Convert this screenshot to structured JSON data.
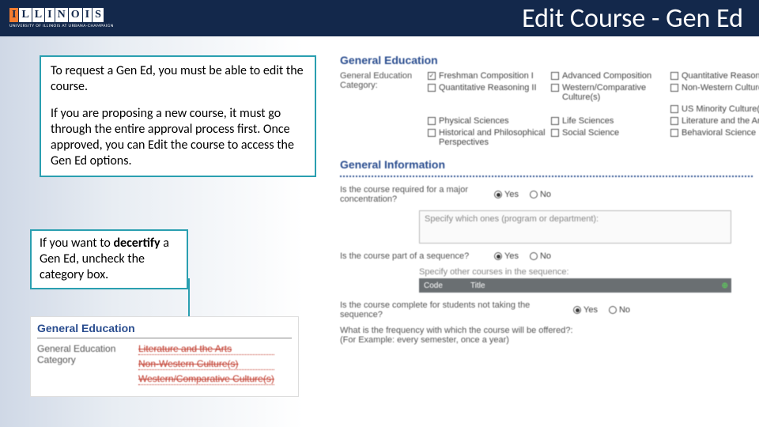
{
  "header": {
    "logo_letters": "ILLINOIS",
    "logo_sub": "UNIVERSITY OF ILLINOIS AT URBANA-CHAMPAIGN",
    "title": "Edit Course - Gen Ed"
  },
  "callout1": {
    "p1": "To request a Gen Ed, you must be able to edit the course.",
    "p2": "If you are proposing a new course, it must go through the entire approval process first. Once approved, you can Edit the course to access the Gen Ed options."
  },
  "callout2": {
    "pre": "If you want to ",
    "bold": "decertify",
    "post": " a Gen Ed, uncheck the category box."
  },
  "bottom_panel": {
    "section": "General Education",
    "label_line1": "General Education",
    "label_line2": "Category",
    "val1": "Literature and the Arts",
    "val2": "Non-Western Culture(s)",
    "val3": "Western/Comparative Culture(s)"
  },
  "right": {
    "ge_section": "General Education",
    "ge_label": "General Education Category:",
    "checks": {
      "c1": "Freshman Composition I",
      "c2": "Advanced Composition",
      "c3": "Quantitative Reasoning I",
      "c4": "Quantitative Reasoning II",
      "c5": "Western/Comparative Culture(s)",
      "c6": "Non-Western Culture(s)",
      "c7": "US Minority Culture(s)",
      "c8": "Physical Sciences",
      "c9": "Life Sciences",
      "c10": "Literature and the Arts",
      "c11": "Historical and Philosophical Perspectives",
      "c12": "Social Science",
      "c13": "Behavioral Science"
    },
    "gi_section": "General Information",
    "q1": "Is the course required for a major concentration?",
    "yes": "Yes",
    "no": "No",
    "spec1": "Specify which ones (program or department):",
    "q2": "Is the course part of a sequence?",
    "spec2": "Specify other courses in the sequence:",
    "th_code": "Code",
    "th_title": "Title",
    "q3": "Is the course complete for students not taking the sequence?",
    "q4": "What is the frequency with which the course will be offered?:",
    "q4sub": "(For Example: every semester, once a year)"
  }
}
